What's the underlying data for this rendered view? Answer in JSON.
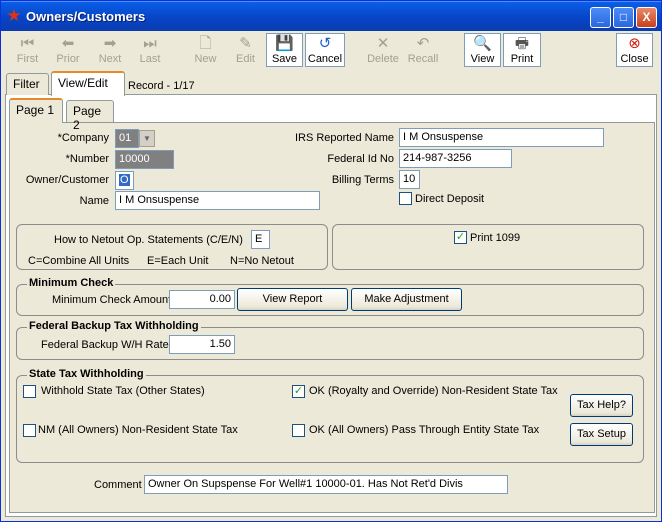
{
  "window": {
    "title": "Owners/Customers",
    "min_label": "_",
    "max_label": "□",
    "close_label": "X"
  },
  "toolbar": {
    "first": "First",
    "prior": "Prior",
    "next": "Next",
    "last": "Last",
    "new": "New",
    "edit": "Edit",
    "save": "Save",
    "cancel": "Cancel",
    "delete": "Delete",
    "recall": "Recall",
    "view": "View",
    "print": "Print",
    "close": "Close"
  },
  "tabs": {
    "filter": "Filter",
    "view_edit": "View/Edit",
    "record": "Record - 1/17"
  },
  "page_tabs": {
    "page1": "Page 1",
    "page2": "Page 2"
  },
  "form": {
    "company_label": "*Company",
    "company_value": "01",
    "number_label": "*Number",
    "number_value": "10000",
    "owner_customer_label": "Owner/Customer",
    "owner_customer_value": "O",
    "name_label": "Name",
    "name_value": "I M Onsuspense",
    "irs_name_label": "IRS Reported Name",
    "irs_name_value": "I M Onsuspense",
    "federal_id_label": "Federal Id No",
    "federal_id_value": "214-987-3256",
    "billing_terms_label": "Billing Terms",
    "billing_terms_value": "10",
    "direct_deposit_label": "Direct Deposit",
    "direct_deposit_checked": false
  },
  "netout": {
    "question": "How to Netout Op. Statements (C/E/N)",
    "value": "E",
    "opt_c": "C=Combine All Units",
    "opt_e": "E=Each Unit",
    "opt_n": "N=No Netout",
    "print1099_label": "Print 1099",
    "print1099_checked": true
  },
  "min_check": {
    "title": "Minimum Check",
    "amount_label": "Minimum Check Amount",
    "amount_value": "0.00",
    "view_report": "View Report",
    "make_adjustment": "Make Adjustment"
  },
  "backup_tax": {
    "title": "Federal Backup Tax Withholding",
    "rate_label": "Federal Backup W/H Rate",
    "rate_value": "1.50"
  },
  "state_tax": {
    "title": "State Tax Withholding",
    "withhold_other": "Withhold State Tax (Other States)",
    "withhold_other_checked": false,
    "ok_royalty": "OK (Royalty and Override) Non-Resident State Tax",
    "ok_royalty_checked": true,
    "nm_all": "NM (All Owners) Non-Resident State Tax",
    "nm_all_checked": false,
    "ok_pass": "OK (All Owners) Pass Through Entity State Tax",
    "ok_pass_checked": false,
    "tax_help": "Tax Help?",
    "tax_setup": "Tax Setup"
  },
  "comment": {
    "label": "Comment",
    "value": "Owner On Supspense For Well#1  10000-01. Has Not Ret'd Divis"
  },
  "colors": {
    "title_bar": "#0744c6",
    "window_bg": "#ece9d8",
    "active_tab_accent": "#e68b2c",
    "check_green": "#21a121"
  }
}
